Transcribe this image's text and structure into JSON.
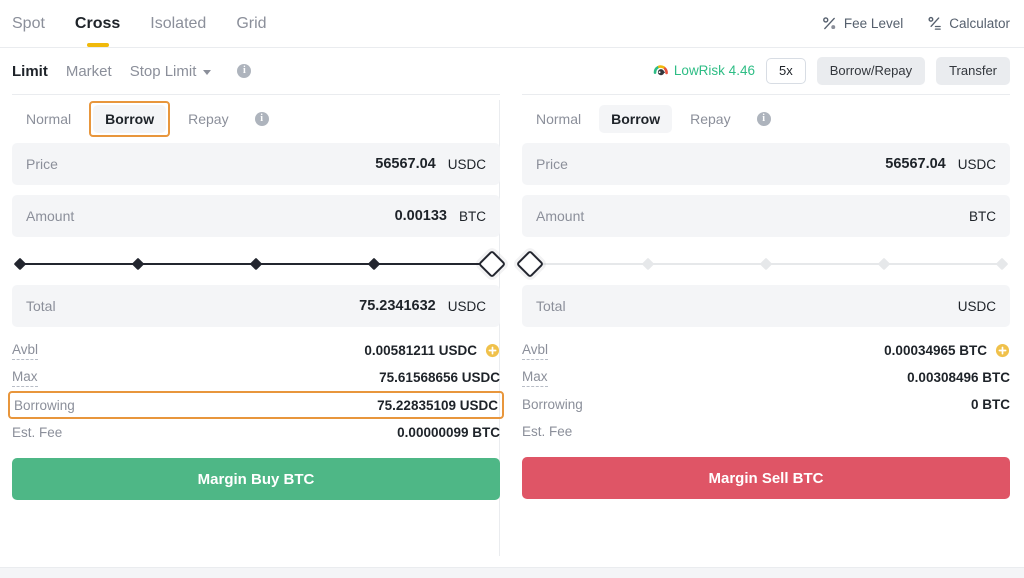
{
  "topbar": {
    "tabs": [
      {
        "label": "Spot",
        "active": false
      },
      {
        "label": "Cross",
        "active": true
      },
      {
        "label": "Isolated",
        "active": false
      },
      {
        "label": "Grid",
        "active": false
      }
    ],
    "fee_level_label": "Fee Level",
    "fee_level_icon": "percent-icon",
    "calculator_label": "Calculator",
    "calculator_icon": "calculator-percent-icon",
    "active_underline_color": "#f0b90b"
  },
  "typebar": {
    "tabs": [
      {
        "label": "Limit",
        "active": true,
        "caret": false
      },
      {
        "label": "Market",
        "active": false,
        "caret": false
      },
      {
        "label": "Stop Limit",
        "active": false,
        "caret": true
      }
    ],
    "info_icon": "info-icon",
    "risk": {
      "icon": "risk-gauge-icon",
      "label": "LowRisk 4.46",
      "color": "#2ebd85"
    },
    "leverage": "5x",
    "borrow_repay_label": "Borrow/Repay",
    "transfer_label": "Transfer"
  },
  "buy": {
    "modes": [
      {
        "label": "Normal",
        "active": false
      },
      {
        "label": "Borrow",
        "active": true
      },
      {
        "label": "Repay",
        "active": false
      }
    ],
    "mode_focused": "Borrow",
    "price": {
      "label": "Price",
      "value": "56567.04",
      "unit": "USDC",
      "placeholder": "Price"
    },
    "amount": {
      "label": "Amount",
      "value": "0.00133",
      "unit": "BTC",
      "placeholder": "Amount"
    },
    "slider": {
      "percent": 100,
      "stops": [
        0,
        25,
        50,
        75,
        100
      ]
    },
    "total": {
      "label": "Total",
      "value": "75.2341632",
      "unit": "USDC",
      "placeholder": "Total"
    },
    "rows": [
      {
        "key": "Avbl",
        "value": "0.00581211 USDC",
        "dotted": true,
        "plus": true,
        "boxed": false
      },
      {
        "key": "Max",
        "value": "75.61568656 USDC",
        "dotted": true,
        "plus": false,
        "boxed": false
      },
      {
        "key": "Borrowing",
        "value": "75.22835109 USDC",
        "dotted": false,
        "plus": false,
        "boxed": true
      },
      {
        "key": "Est. Fee",
        "value": "0.00000099 BTC",
        "dotted": false,
        "plus": false,
        "boxed": false
      }
    ],
    "submit_label": "Margin Buy BTC",
    "submit_color": "#4eb786"
  },
  "sell": {
    "modes": [
      {
        "label": "Normal",
        "active": false
      },
      {
        "label": "Borrow",
        "active": true
      },
      {
        "label": "Repay",
        "active": false
      }
    ],
    "price": {
      "label": "Price",
      "value": "56567.04",
      "unit": "USDC",
      "placeholder": "Price"
    },
    "amount": {
      "label": "Amount",
      "value": "",
      "unit": "BTC",
      "placeholder": "Amount"
    },
    "slider": {
      "percent": 0,
      "stops": [
        0,
        25,
        50,
        75,
        100
      ]
    },
    "total": {
      "label": "Total",
      "value": "",
      "unit": "USDC",
      "placeholder": "Total"
    },
    "rows": [
      {
        "key": "Avbl",
        "value": "0.00034965 BTC",
        "dotted": true,
        "plus": true,
        "boxed": false
      },
      {
        "key": "Max",
        "value": "0.00308496 BTC",
        "dotted": true,
        "plus": false,
        "boxed": false
      },
      {
        "key": "Borrowing",
        "value": "0 BTC",
        "dotted": false,
        "plus": false,
        "boxed": false
      },
      {
        "key": "Est. Fee",
        "value": "",
        "dotted": false,
        "plus": false,
        "boxed": false
      }
    ],
    "submit_label": "Margin Sell BTC",
    "submit_color": "#df5566"
  },
  "theme": {
    "accent_orange": "#e8963c",
    "yellow": "#f0b90b",
    "green": "#2ebd85",
    "red": "#df5566",
    "muted": "#8b8f9a"
  }
}
